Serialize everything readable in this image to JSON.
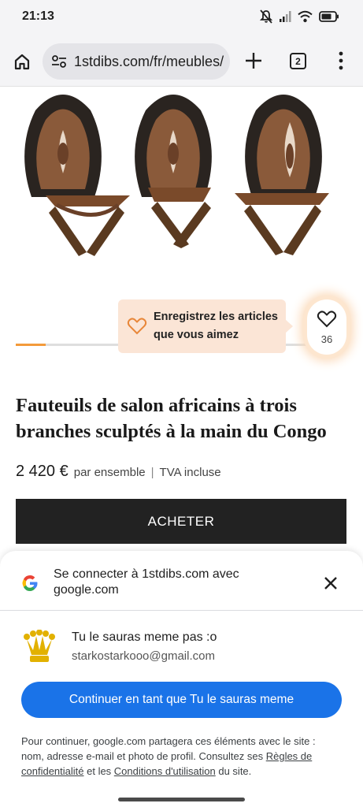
{
  "status_bar": {
    "time": "21:13",
    "icons": [
      "bell-off-icon",
      "signal-icon",
      "wifi-icon",
      "battery-icon"
    ]
  },
  "browser": {
    "url": "1stdibs.com/fr/meubles/",
    "tab_count": "2",
    "icons": [
      "home-icon",
      "site-settings-icon",
      "plus-icon",
      "more-vert-icon"
    ]
  },
  "product": {
    "image_alt": "Trois fauteuils africains sculptés",
    "carousel_progress": 0.09,
    "save_prompt": "Enregistrez les articles que vous aimez",
    "favorite_count": "36",
    "title": "Fauteuils de salon africains à trois branches sculptés à la main du Congo",
    "price": "2 420 €",
    "price_unit": "par ensemble",
    "price_separator": "|",
    "tax_note": "TVA incluse",
    "buy_label": "ACHETER"
  },
  "signin": {
    "title": "Se connecter à 1stdibs.com avec google.com",
    "account_name": "Tu le sauras meme pas :o",
    "account_email": "starkostarkooo@gmail.com",
    "continue_label": "Continuer en tant que Tu le sauras meme",
    "disclaimer_before": "Pour continuer, google.com partagera ces éléments avec le site : nom, adresse e-mail et photo de profil. Consultez ses ",
    "privacy_link": "Règles de confidentialité",
    "disclaimer_middle": " et les ",
    "terms_link": "Conditions d'utilisation",
    "disclaimer_after": " du site."
  },
  "colors": {
    "accent_orange": "#f39a3a",
    "tooltip_bg": "#fbe5d6",
    "google_blue": "#1a73e8",
    "buy_button": "#222222"
  }
}
